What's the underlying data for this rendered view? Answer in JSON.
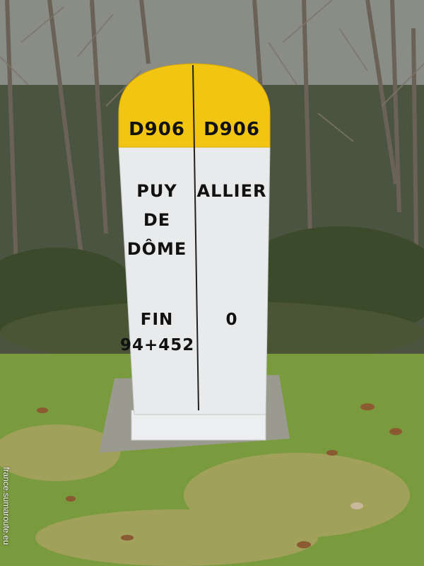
{
  "marker": {
    "left_face": {
      "road": "D906",
      "department_lines": [
        "PUY",
        "DE",
        "DÔME"
      ],
      "distance_lines": [
        "FIN",
        "94+452"
      ]
    },
    "right_face": {
      "road": "D906",
      "department_lines": [
        "ALLIER"
      ],
      "distance_lines": [
        "0"
      ]
    }
  },
  "watermark": "france.sumaroute.eu",
  "colors": {
    "cap_yellow": "#f2c513",
    "stone_white": "#e8eaeb",
    "grass": "#7a9a3e",
    "forest": "#3e4a30"
  }
}
